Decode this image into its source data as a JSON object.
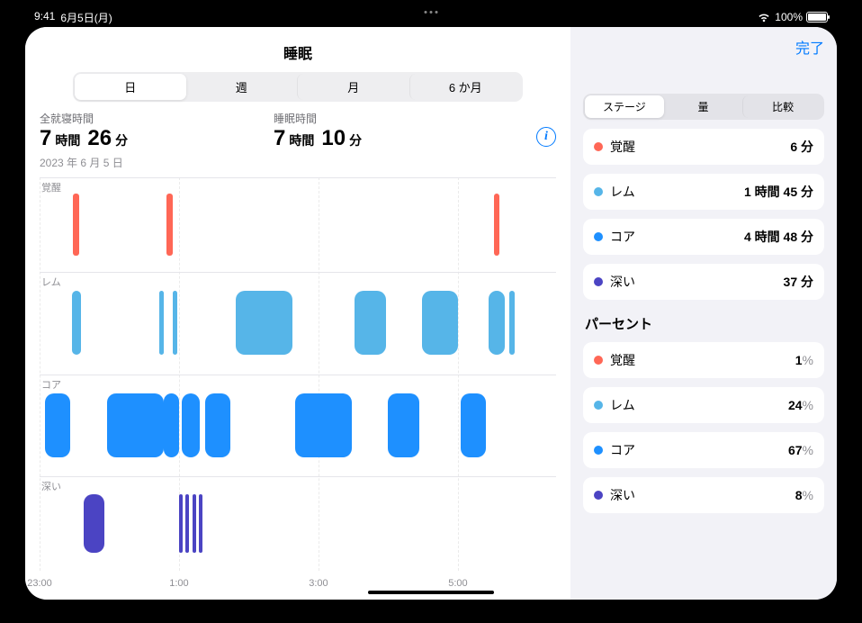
{
  "status": {
    "time": "9:41",
    "date": "6月5日(月)",
    "battery": "100%"
  },
  "header": {
    "title": "睡眠",
    "done": "完了"
  },
  "range_tabs": {
    "day": "日",
    "week": "週",
    "month": "月",
    "six_month": "6 か月",
    "active": "day"
  },
  "summary": {
    "in_bed_label": "全就寝時間",
    "in_bed_hours": "7",
    "in_bed_h_unit": "時間",
    "in_bed_min": "26",
    "in_bed_m_unit": "分",
    "asleep_label": "睡眠時間",
    "asleep_hours": "7",
    "asleep_h_unit": "時間",
    "asleep_min": "10",
    "asleep_m_unit": "分",
    "date": "2023 年 6 月 5 日"
  },
  "stage_labels": {
    "awake": "覚醒",
    "rem": "レム",
    "core": "コア",
    "deep": "深い"
  },
  "time_axis": [
    "23:00",
    "1:00",
    "3:00",
    "5:00"
  ],
  "side_tabs": {
    "stages": "ステージ",
    "amounts": "量",
    "compare": "比較",
    "active": "stages"
  },
  "side_durations": {
    "awake": {
      "label": "覚醒",
      "value": "6 分"
    },
    "rem": {
      "label": "レム",
      "value": "1 時間 45 分"
    },
    "core": {
      "label": "コア",
      "value": "4 時間 48 分"
    },
    "deep": {
      "label": "深い",
      "value": "37 分"
    }
  },
  "percent_title": "パーセント",
  "side_percent": {
    "awake": {
      "label": "覚醒",
      "value": "1"
    },
    "rem": {
      "label": "レム",
      "value": "24"
    },
    "core": {
      "label": "コア",
      "value": "67"
    },
    "deep": {
      "label": "深い",
      "value": "8"
    }
  },
  "chart_data": {
    "type": "sleep-stages",
    "stages": [
      "awake",
      "rem",
      "core",
      "deep"
    ],
    "stage_bands_pct": {
      "awake": [
        0,
        24
      ],
      "rem": [
        24,
        50
      ],
      "core": [
        50,
        76
      ],
      "deep": [
        76,
        100
      ]
    },
    "x_start": "23:00",
    "x_end": "6:26",
    "time_ticks_pct": {
      "23:00": 0,
      "1:00": 27,
      "3:00": 54,
      "5:00": 81
    },
    "bars": [
      {
        "stage": "core",
        "x": 1,
        "w": 5
      },
      {
        "stage": "awake",
        "x": 6.5,
        "w": 1.2
      },
      {
        "stage": "rem",
        "x": 6.2,
        "w": 1.8
      },
      {
        "stage": "deep",
        "x": 8.5,
        "w": 4
      },
      {
        "stage": "core",
        "x": 13,
        "w": 11
      },
      {
        "stage": "awake",
        "x": 24.5,
        "w": 1.2
      },
      {
        "stage": "rem",
        "x": 23.2,
        "w": 0.8
      },
      {
        "stage": "rem",
        "x": 25.8,
        "w": 0.8
      },
      {
        "stage": "core",
        "x": 24,
        "w": 3
      },
      {
        "stage": "core",
        "x": 27.5,
        "w": 3.5
      },
      {
        "stage": "deep",
        "x": 27,
        "w": 0.7
      },
      {
        "stage": "deep",
        "x": 28.3,
        "w": 0.7
      },
      {
        "stage": "deep",
        "x": 29.6,
        "w": 0.7
      },
      {
        "stage": "deep",
        "x": 30.9,
        "w": 0.7
      },
      {
        "stage": "core",
        "x": 32,
        "w": 5
      },
      {
        "stage": "rem",
        "x": 38,
        "w": 11
      },
      {
        "stage": "core",
        "x": 49.5,
        "w": 11
      },
      {
        "stage": "rem",
        "x": 61,
        "w": 6
      },
      {
        "stage": "core",
        "x": 67.5,
        "w": 6
      },
      {
        "stage": "rem",
        "x": 74,
        "w": 7
      },
      {
        "stage": "core",
        "x": 81.5,
        "w": 5
      },
      {
        "stage": "awake",
        "x": 88,
        "w": 1
      },
      {
        "stage": "rem",
        "x": 87,
        "w": 3
      },
      {
        "stage": "rem",
        "x": 91,
        "w": 1
      }
    ]
  },
  "colors": {
    "awake": "#ff6756",
    "rem": "#56b5e8",
    "core": "#1e90ff",
    "deep": "#4b44c3",
    "accent": "#007aff"
  }
}
